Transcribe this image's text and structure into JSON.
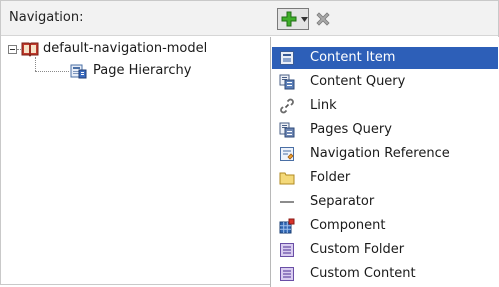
{
  "header": {
    "title": "Navigation:"
  },
  "toolbar": {
    "add_icon": "green-plus-icon",
    "dropdown_icon": "chevron-down-icon",
    "delete_icon": "gray-x-icon"
  },
  "tree": {
    "root": {
      "label": "default-navigation-model",
      "icon": "book-icon"
    },
    "child": {
      "label": "Page Hierarchy",
      "icon": "page-hierarchy-icon"
    }
  },
  "menu": {
    "selected_color": "#2d5fb8",
    "items": [
      {
        "label": "Content Item",
        "icon": "content-item-icon"
      },
      {
        "label": "Content Query",
        "icon": "content-query-icon"
      },
      {
        "label": "Link",
        "icon": "chain-link-icon"
      },
      {
        "label": "Pages Query",
        "icon": "pages-query-icon"
      },
      {
        "label": "Navigation Reference",
        "icon": "navigation-reference-icon"
      },
      {
        "label": "Folder",
        "icon": "folder-icon"
      },
      {
        "label": "Separator",
        "icon": "separator-icon"
      },
      {
        "label": "Component",
        "icon": "component-icon"
      },
      {
        "label": "Custom Folder",
        "icon": "custom-folder-icon"
      },
      {
        "label": "Custom Content",
        "icon": "custom-content-icon"
      }
    ]
  }
}
